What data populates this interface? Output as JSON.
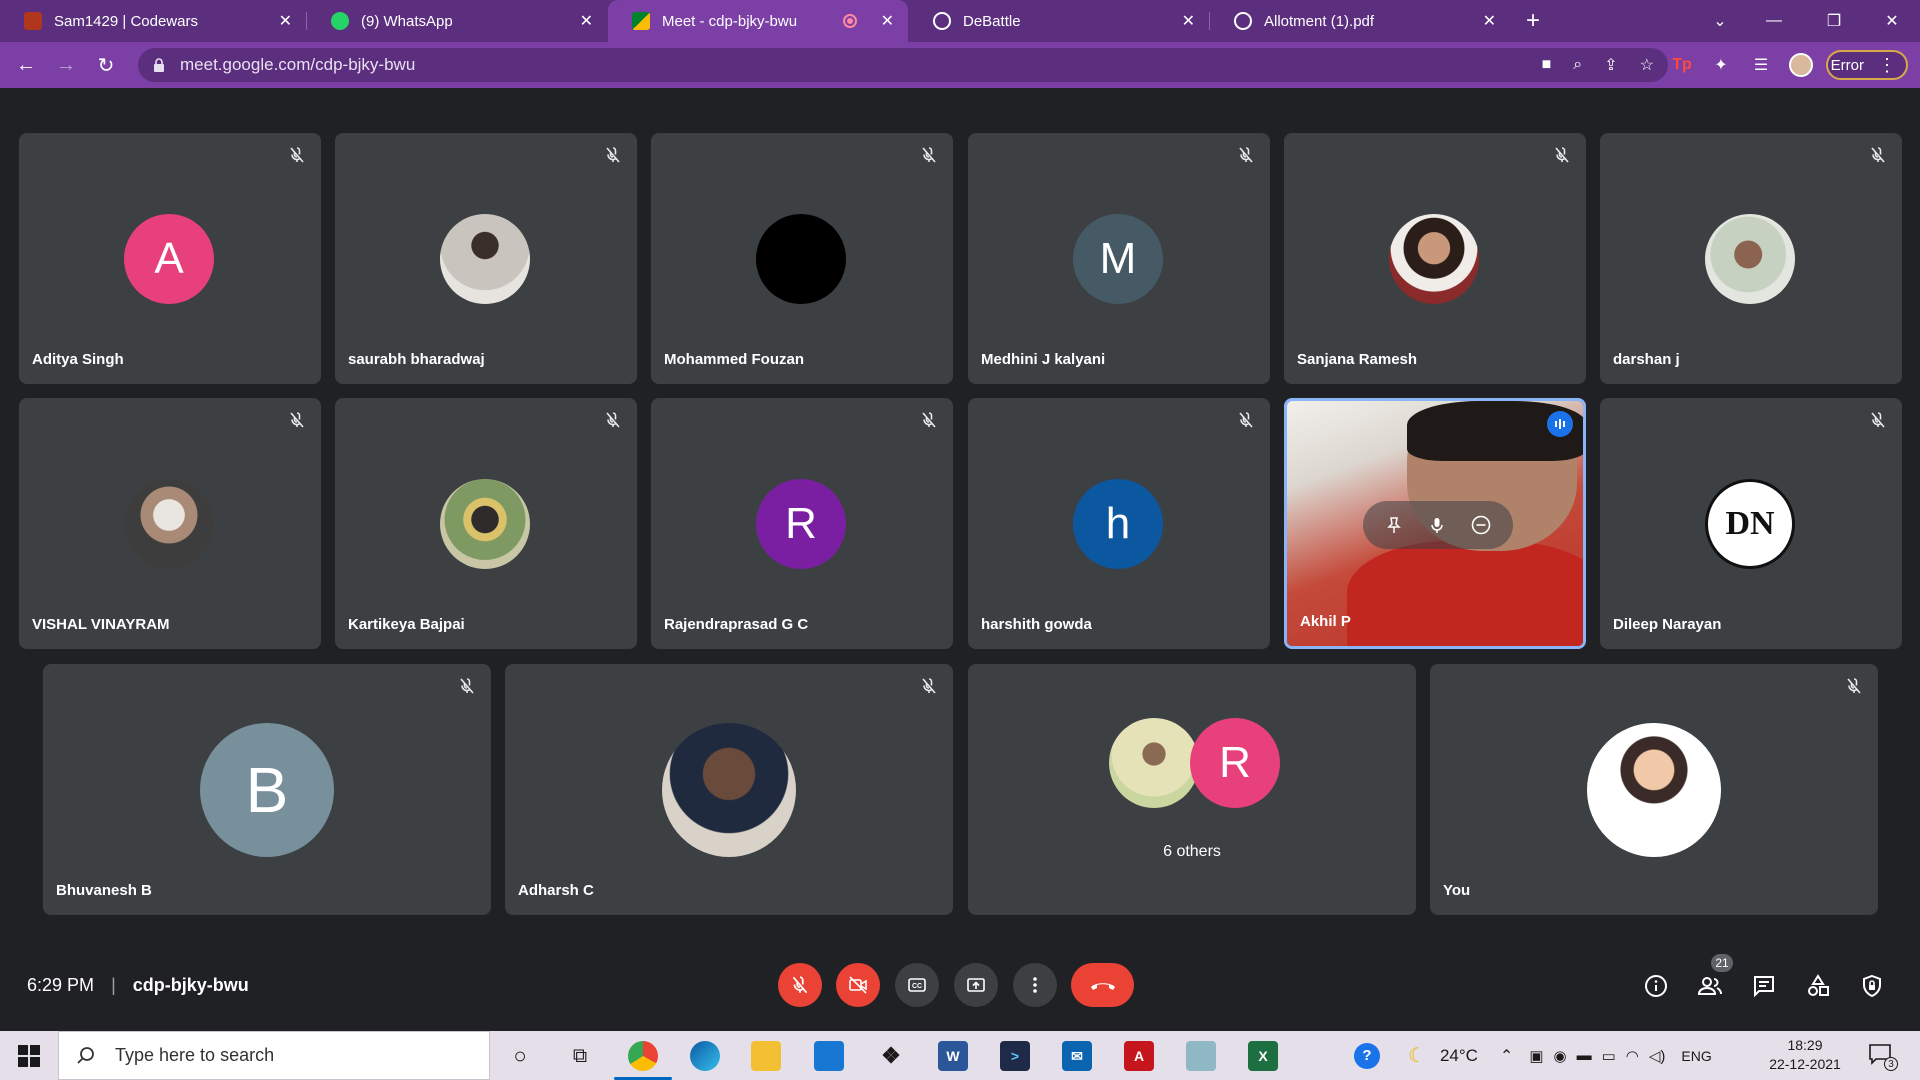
{
  "browser": {
    "tabs": [
      {
        "title": "Sam1429 | Codewars",
        "icon": "codewars-icon",
        "color": "#b1361e",
        "active": false
      },
      {
        "title": "(9) WhatsApp",
        "icon": "whatsapp-icon",
        "color": "#25d366",
        "active": false
      },
      {
        "title": "Meet - cdp-bjky-bwu",
        "icon": "meet-icon",
        "color": "#00832d",
        "active": true
      },
      {
        "title": "DeBattle",
        "icon": "globe-icon",
        "color": "#ffffff",
        "active": false
      },
      {
        "title": "Allotment (1).pdf",
        "icon": "globe-icon",
        "color": "#ffffff",
        "active": false
      }
    ],
    "url": "meet.google.com/cdp-bjky-bwu",
    "error_label": "Error"
  },
  "meeting": {
    "participants_row1": [
      {
        "name": "Aditya Singh",
        "initial": "A",
        "color": "#e8407a",
        "type": "letter"
      },
      {
        "name": "saurabh bharadwaj",
        "type": "photo",
        "color": "#9aa0a6"
      },
      {
        "name": "Mohammed Fouzan",
        "type": "photo",
        "color": "#000000"
      },
      {
        "name": "Medhini J kalyani",
        "initial": "M",
        "color": "#455a64",
        "type": "letter"
      },
      {
        "name": "Sanjana Ramesh",
        "type": "photo",
        "color": "#8d6e63"
      },
      {
        "name": "darshan j",
        "type": "photo",
        "color": "#7a8a7a"
      }
    ],
    "participants_row2": [
      {
        "name": "VISHAL VINAYRAM",
        "type": "photo",
        "color": "#6e6e6e"
      },
      {
        "name": "Kartikeya Bajpai",
        "type": "photo",
        "color": "#6d8a5a"
      },
      {
        "name": "Rajendraprasad G C",
        "initial": "R",
        "color": "#7b1fa2",
        "type": "letter"
      },
      {
        "name": "harshith gowda",
        "initial": "h",
        "color": "#0b57a0",
        "type": "letter"
      },
      {
        "name": "Akhil P",
        "type": "video"
      },
      {
        "name": "Dileep Narayan",
        "type": "logo",
        "logo_text": "DN"
      }
    ],
    "participants_row3": [
      {
        "name": "Bhuvanesh B",
        "initial": "B",
        "color": "#78909c",
        "type": "letter"
      },
      {
        "name": "Adharsh C",
        "type": "photo",
        "color": "#5d4a40"
      },
      {
        "name": "",
        "type": "others",
        "others_label": "6 others",
        "initial": "R",
        "color": "#e8407a"
      },
      {
        "name": "You",
        "type": "photo",
        "color": "#ffffff"
      }
    ],
    "time": "6:29 PM",
    "code": "cdp-bjky-bwu",
    "people_count": "21"
  },
  "taskbar": {
    "search_placeholder": "Type here to search",
    "weather": "24°C",
    "lang": "ENG",
    "time": "18:29",
    "date": "22-12-2021",
    "notif_count": "3"
  }
}
